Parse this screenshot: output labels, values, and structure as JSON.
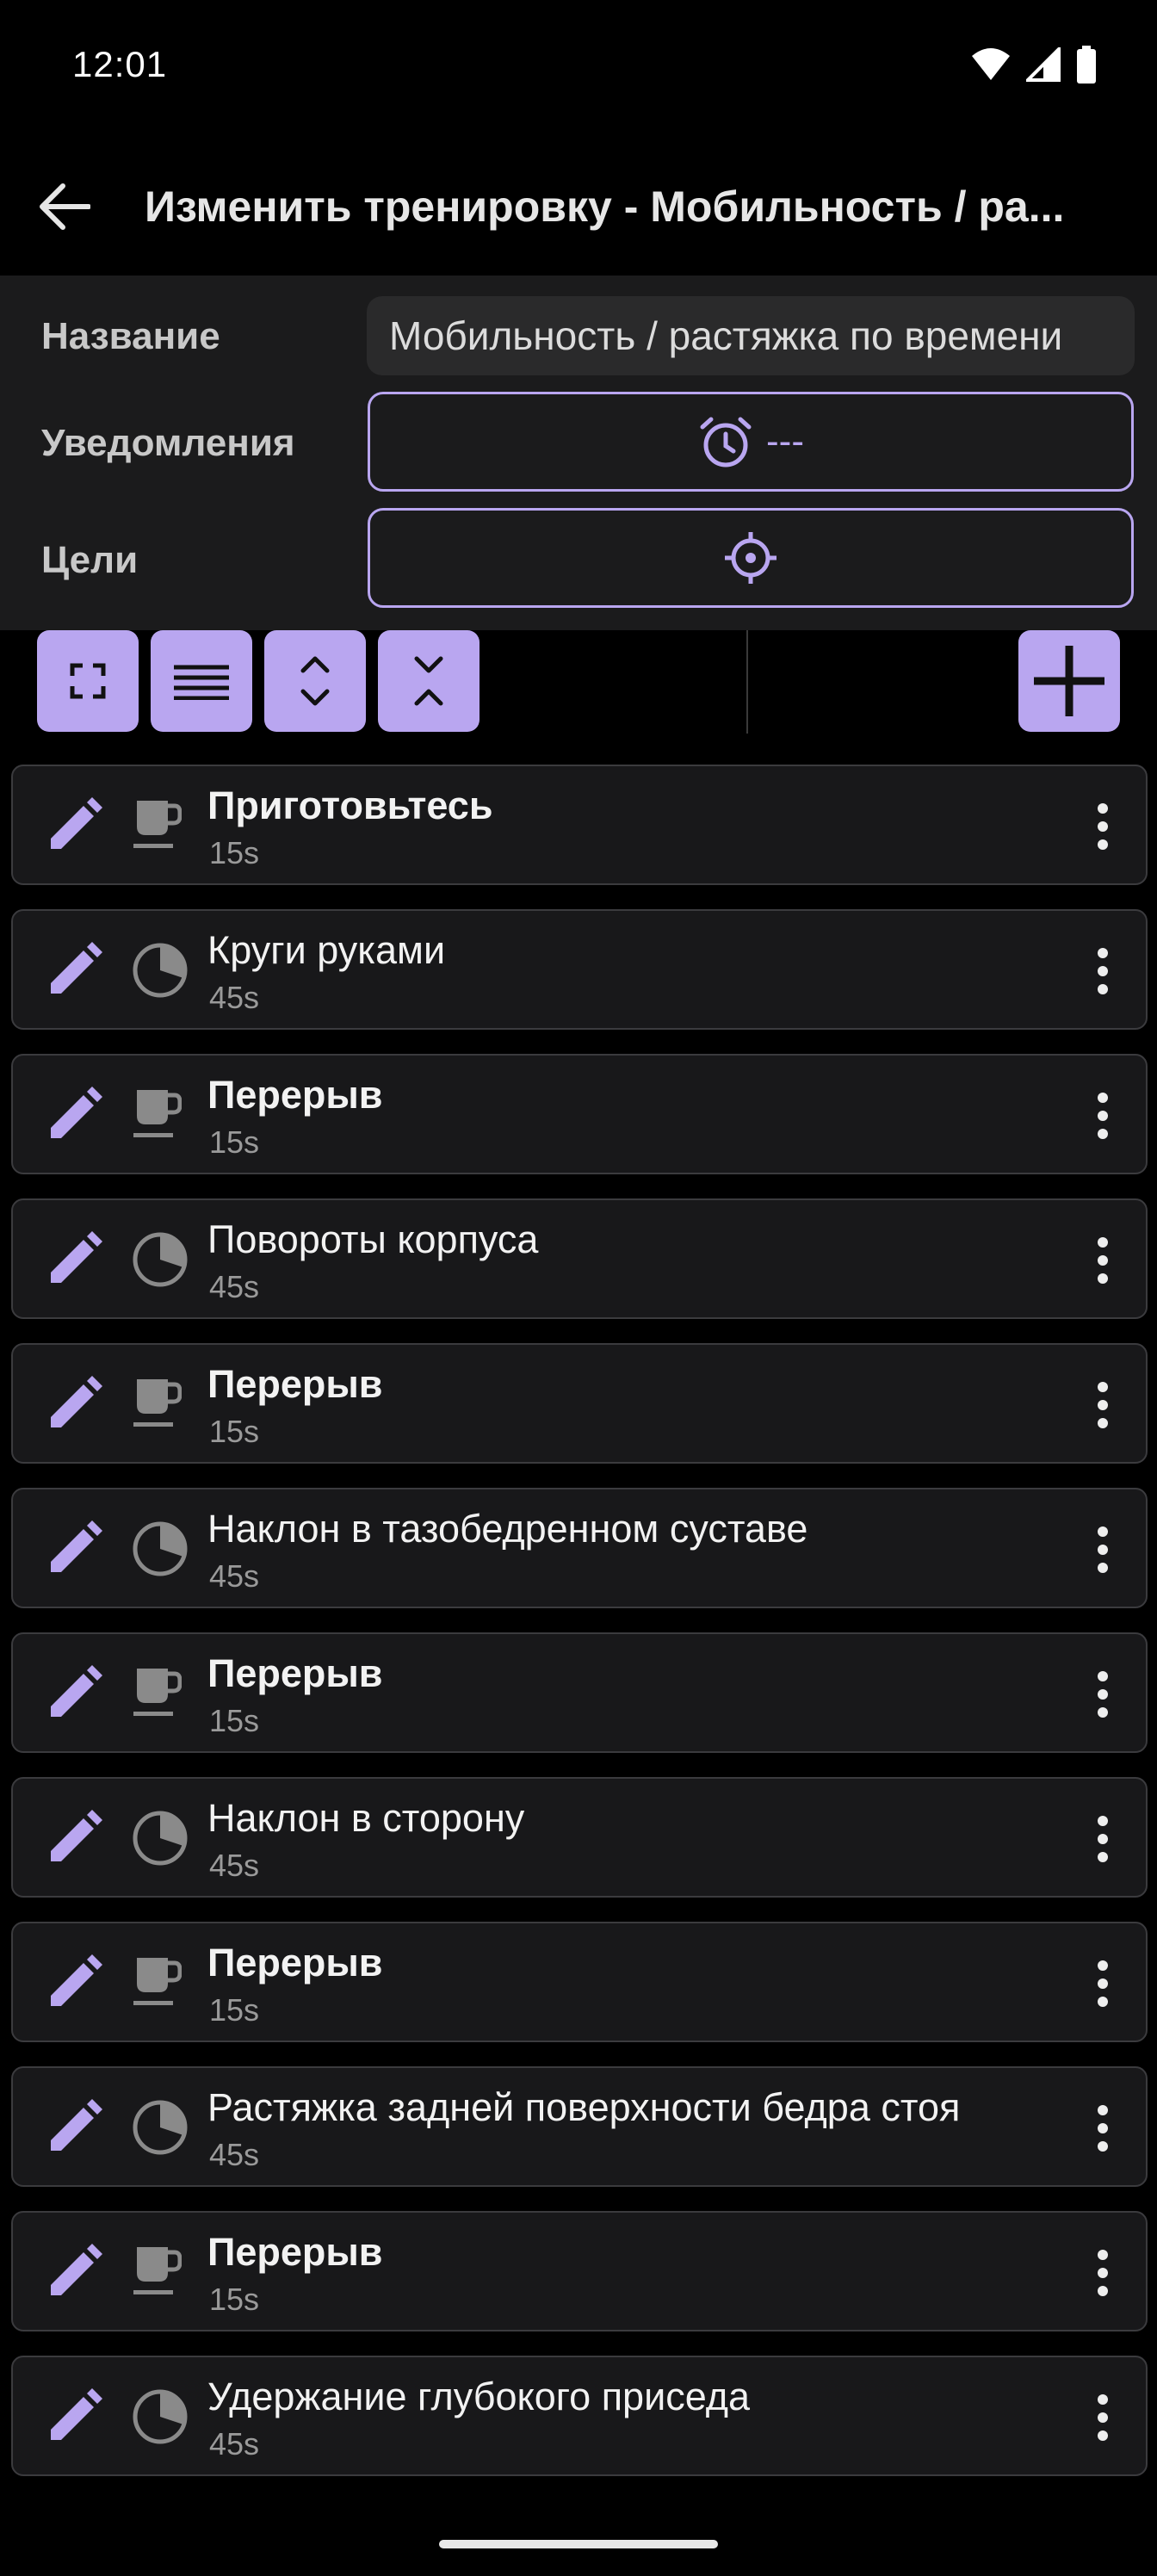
{
  "status": {
    "time": "12:01"
  },
  "app_bar": {
    "title": "Изменить тренировку - Мобильность / ра..."
  },
  "form": {
    "name_label": "Название",
    "name_value": "Мобильность / растяжка по времени",
    "notifications_label": "Уведомления",
    "notifications_value": "---",
    "goals_label": "Цели"
  },
  "colors": {
    "accent": "#b9a6f0",
    "panel": "#1b1b1c",
    "row_bg": "#18181a"
  },
  "items": [
    {
      "title": "Приготовьтесь",
      "duration": "15s",
      "type": "rest",
      "icon": "coffee-cup-icon"
    },
    {
      "title": "Круги руками",
      "duration": "45s",
      "type": "exercise",
      "icon": "timer-pie-icon"
    },
    {
      "title": "Перерыв",
      "duration": "15s",
      "type": "rest",
      "icon": "coffee-cup-icon"
    },
    {
      "title": "Повороты корпуса",
      "duration": "45s",
      "type": "exercise",
      "icon": "timer-pie-icon"
    },
    {
      "title": "Перерыв",
      "duration": "15s",
      "type": "rest",
      "icon": "coffee-cup-icon"
    },
    {
      "title": "Наклон в тазобедренном суставе",
      "duration": "45s",
      "type": "exercise",
      "icon": "timer-pie-icon"
    },
    {
      "title": "Перерыв",
      "duration": "15s",
      "type": "rest",
      "icon": "coffee-cup-icon"
    },
    {
      "title": "Наклон в сторону",
      "duration": "45s",
      "type": "exercise",
      "icon": "timer-pie-icon"
    },
    {
      "title": "Перерыв",
      "duration": "15s",
      "type": "rest",
      "icon": "coffee-cup-icon"
    },
    {
      "title": "Растяжка задней поверхности бедра стоя",
      "duration": "45s",
      "type": "exercise",
      "icon": "timer-pie-icon"
    },
    {
      "title": "Перерыв",
      "duration": "15s",
      "type": "rest",
      "icon": "coffee-cup-icon"
    },
    {
      "title": "Удержание глубокого приседа",
      "duration": "45s",
      "type": "exercise",
      "icon": "timer-pie-icon"
    }
  ]
}
